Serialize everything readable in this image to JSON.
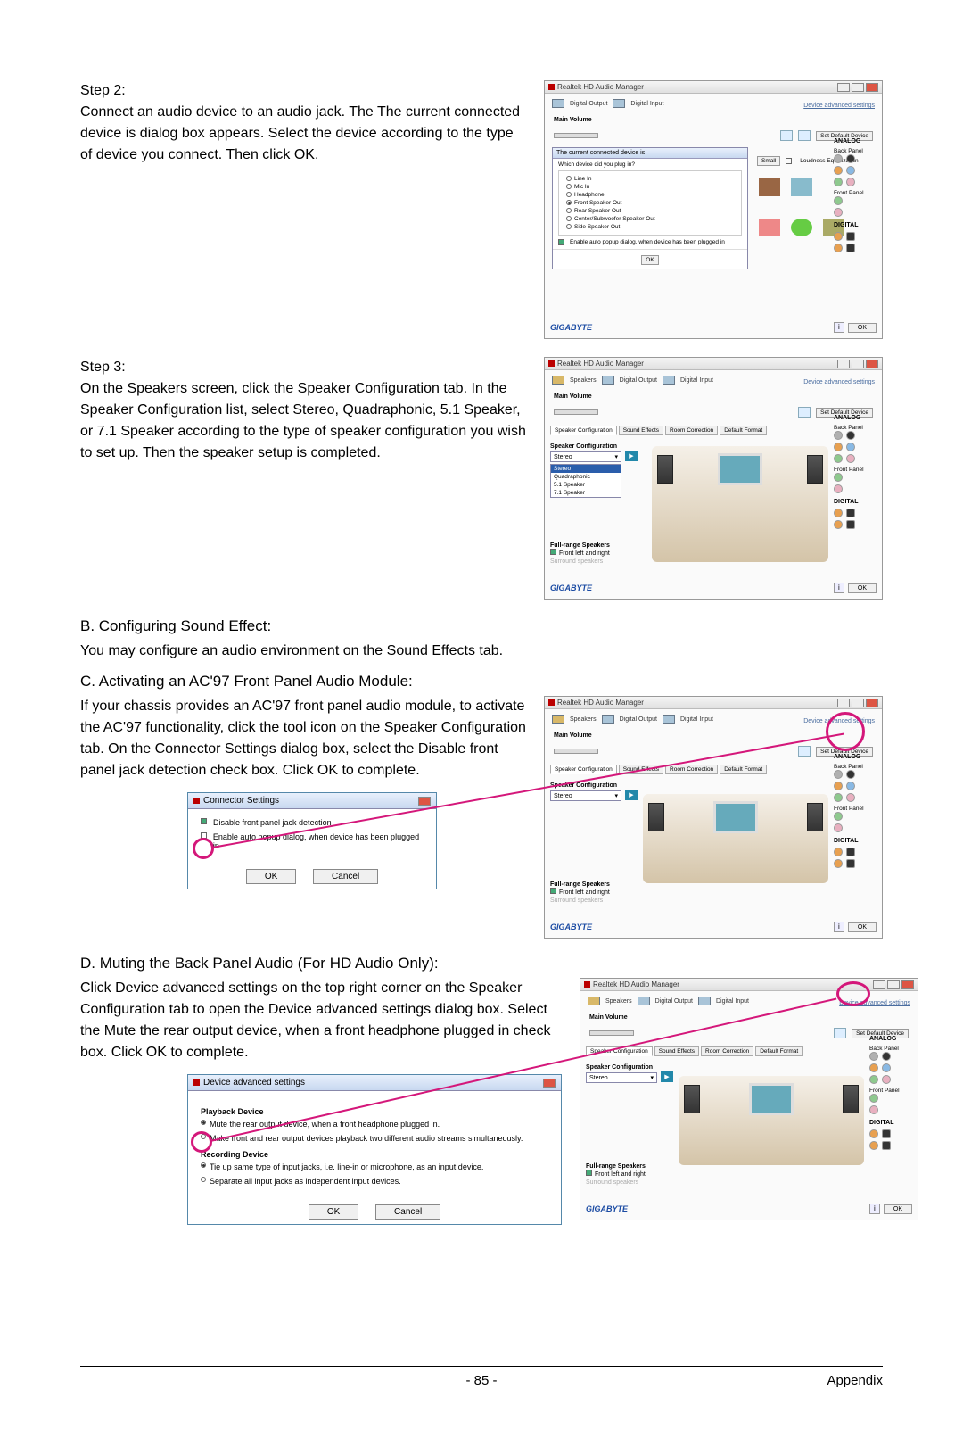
{
  "step2": {
    "label": "Step 2:",
    "text": "Connect an audio device to an audio jack. The The current connected device is dialog box appears. Select the device according to the type of device you connect. Then click OK."
  },
  "step3": {
    "label": "Step 3:",
    "text": "On the Speakers screen, click the Speaker Configuration tab. In the Speaker Configuration list, select Stereo, Quadraphonic, 5.1 Speaker, or 7.1 Speaker according to the type of speaker configuration you wish to set up. Then the speaker setup is completed."
  },
  "sectionB": {
    "heading": "B. Configuring Sound Effect:",
    "text": "You may configure an audio environment on the Sound Effects tab."
  },
  "sectionC": {
    "heading": "C. Activating an AC'97 Front Panel Audio Module:",
    "text": "If your chassis provides an AC'97 front panel audio module, to activate the AC'97 functionality, click the tool icon on the Speaker Configuration tab. On the Connector Settings dialog box, select the Disable front panel jack detection check box. Click OK to complete."
  },
  "sectionD": {
    "heading": "D. Muting the Back Panel Audio (For HD Audio Only):",
    "text": "Click Device advanced settings on the top right corner on the Speaker Configuration tab to open the Device advanced settings dialog box. Select the Mute the rear output device, when a front headphone plugged in check box. Click OK to complete."
  },
  "pageNum": "- 85 -",
  "pageSection": "Appendix",
  "realtek": {
    "title": "Realtek HD Audio Manager",
    "tabs": {
      "digitalOutput": "Digital Output",
      "digitalInput": "Digital Input",
      "speakers": "Speakers"
    },
    "advLink": "Device advanced settings",
    "mainVolume": "Main Volume",
    "setDefault": "Set Default Device",
    "analog": "ANALOG",
    "backPanel": "Back Panel",
    "frontPanel": "Front Panel",
    "digital": "DIGITAL",
    "logo": "GIGABYTE",
    "ok": "OK",
    "cancel": "Cancel",
    "dlgQ": "The current connected device is",
    "dlgQ2": "Which device did you plug in?",
    "options": [
      "Line In",
      "Mic In",
      "Headphone",
      "Front Speaker Out",
      "Rear Speaker Out",
      "Center/Subwoofer Speaker Out",
      "Side Speaker Out"
    ],
    "autoPopup": "Enable auto popup dialog, when device has been plugged in",
    "loudness": "Loudness Equalization",
    "spkConfig": "Speaker Configuration",
    "spkSubTabs": [
      "Speaker Configuration",
      "Sound Effects",
      "Room Correction",
      "Default Format"
    ],
    "stereo": "Stereo",
    "configList": [
      "Stereo",
      "Quadraphonic",
      "5.1 Speaker",
      "7.1 Speaker"
    ],
    "fullRange": "Full-range Speakers",
    "frontLR": "Front left and right",
    "surroundSpk": "Surround speakers",
    "small": "Small"
  },
  "connector": {
    "title": "Connector Settings",
    "opt1": "Disable front panel jack detection",
    "opt2": "Enable auto popup dialog, when device has been plugged in",
    "ok": "OK",
    "cancel": "Cancel"
  },
  "devAdv": {
    "title": "Device advanced settings",
    "playback": "Playback Device",
    "opt1": "Mute the rear output device, when a front headphone plugged in.",
    "opt2": "Make front and rear output devices playback two different audio streams simultaneously.",
    "recording": "Recording Device",
    "opt3": "Tie up same type of input jacks, i.e. line-in or microphone, as an input device.",
    "opt4": "Separate all input jacks as independent input devices.",
    "ok": "OK",
    "cancel": "Cancel"
  }
}
